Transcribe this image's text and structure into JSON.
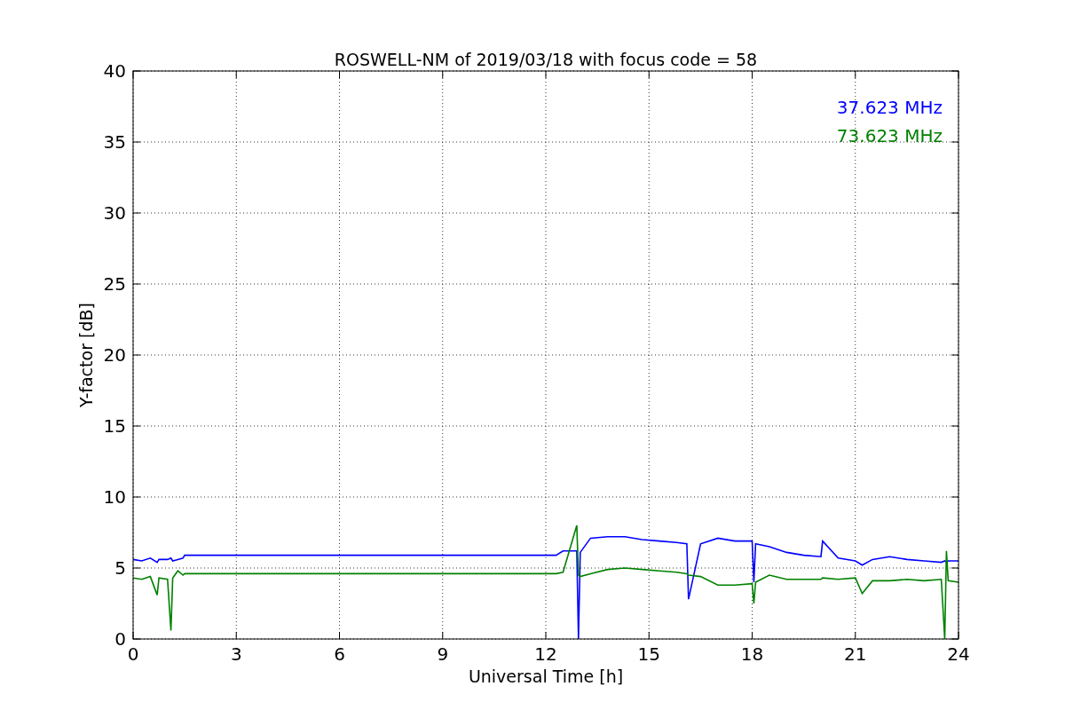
{
  "figure": {
    "chart_data": {
      "type": "line",
      "title": "ROSWELL-NM of 2019/03/18 with focus code = 58",
      "xlabel": "Universal Time [h]",
      "ylabel": "Y-factor [dB]",
      "x": [
        0,
        0.25,
        0.5,
        0.7,
        0.75,
        1,
        1.1,
        1.15,
        1.3,
        1.45,
        1.5,
        12.3,
        12.5,
        12.9,
        12.95,
        13,
        13.3,
        13.8,
        14.3,
        14.8,
        15.3,
        15.8,
        16.1,
        16.15,
        16.5,
        17,
        17.5,
        18,
        18.05,
        18.1,
        18.5,
        19,
        19.5,
        20,
        20.05,
        20.5,
        21,
        21.2,
        21.5,
        22,
        22.5,
        23,
        23.5,
        23.6,
        23.65,
        23.7,
        24
      ],
      "series": [
        {
          "name": "37.623 MHz",
          "color": "#0000ff",
          "values": [
            5.6,
            5.5,
            5.7,
            5.4,
            5.6,
            5.6,
            5.7,
            5.5,
            5.6,
            5.7,
            5.9,
            5.9,
            6.2,
            6.2,
            0,
            6.1,
            7.1,
            7.2,
            7.2,
            7.0,
            6.9,
            6.8,
            6.7,
            2.8,
            6.7,
            7.1,
            6.9,
            6.9,
            4.0,
            6.7,
            6.5,
            6.1,
            5.9,
            5.8,
            6.9,
            5.7,
            5.5,
            5.2,
            5.6,
            5.8,
            5.6,
            5.5,
            5.4,
            5.5,
            5.4,
            5.5,
            5.5
          ]
        },
        {
          "name": "73.623 MHz",
          "color": "#008000",
          "values": [
            4.3,
            4.2,
            4.4,
            3.1,
            4.3,
            4.2,
            0.6,
            4.3,
            4.8,
            4.5,
            4.6,
            4.6,
            4.7,
            8.0,
            4.5,
            4.4,
            4.6,
            4.9,
            5.0,
            4.9,
            4.8,
            4.7,
            4.6,
            4.5,
            4.4,
            3.8,
            3.8,
            3.9,
            2.5,
            4.0,
            4.5,
            4.2,
            4.2,
            4.2,
            4.3,
            4.2,
            4.3,
            3.2,
            4.1,
            4.1,
            4.2,
            4.1,
            4.2,
            0,
            6.2,
            4.1,
            4.0
          ]
        }
      ],
      "grid": true,
      "xlim": [
        0,
        24
      ],
      "ylim": [
        0,
        40
      ],
      "xticks": [
        0,
        3,
        6,
        9,
        12,
        15,
        18,
        21,
        24
      ],
      "yticks": [
        0,
        5,
        10,
        15,
        20,
        25,
        30,
        35,
        40
      ]
    }
  }
}
